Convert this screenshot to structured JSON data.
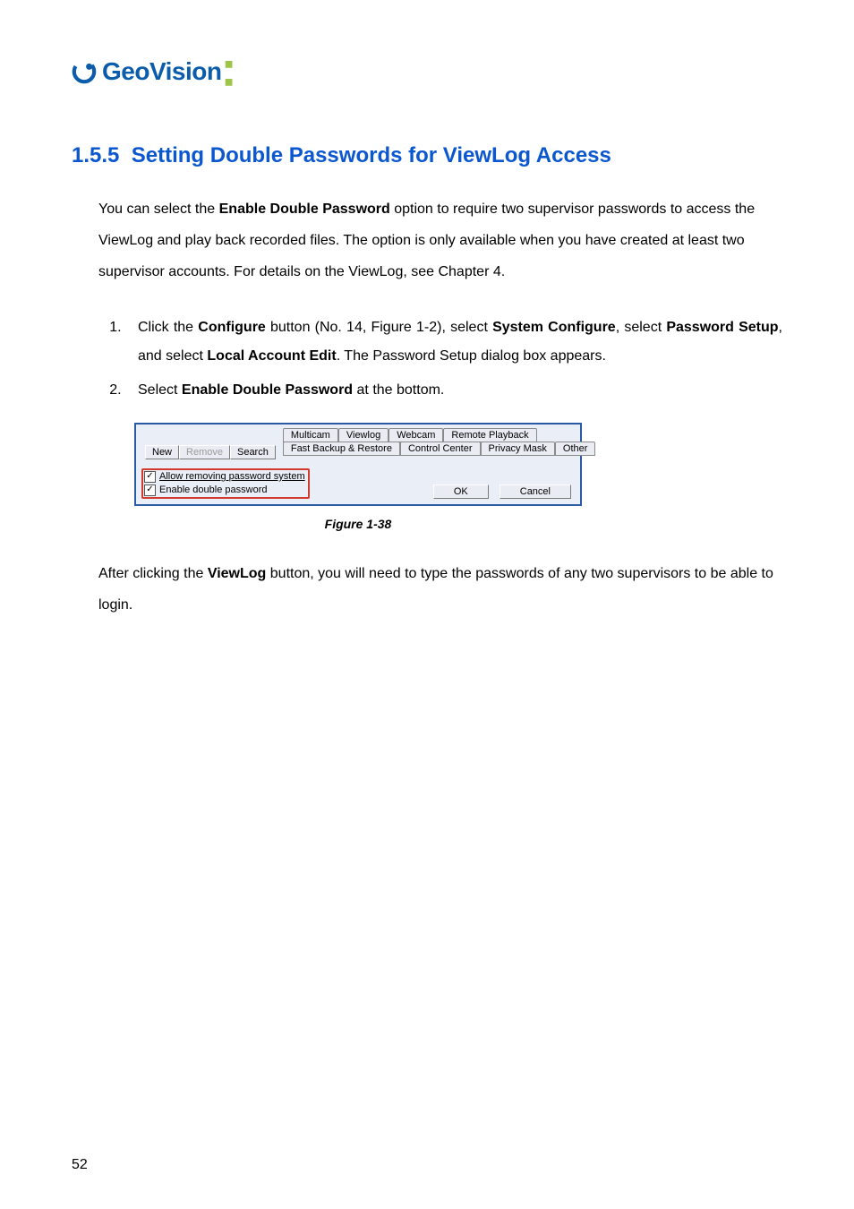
{
  "logo": {
    "brand": "GeoVision"
  },
  "heading": {
    "num": "1.5.5",
    "title": "Setting Double Passwords for ViewLog Access"
  },
  "para1": {
    "pre": "You can select the ",
    "bold1": "Enable Double Password",
    "post": " option to require two supervisor passwords to access the ViewLog and play back recorded files. The option is only available when you have created at least two supervisor accounts. For details on the ViewLog, see Chapter 4."
  },
  "steps": {
    "s1": {
      "a": "Click the ",
      "b": "Configure",
      "c": " button (No. 14, Figure 1-2), select ",
      "d": "System Configure",
      "e": ", select ",
      "f": "Password Setup",
      "g": ", and select ",
      "h": "Local Account Edit",
      "i": ". The Password Setup dialog box appears."
    },
    "s2": {
      "a": "Select ",
      "b": "Enable Double Password",
      "c": " at the bottom."
    }
  },
  "dialog": {
    "buttons": {
      "new": "New",
      "remove": "Remove",
      "search": "Search"
    },
    "tabs_row1": {
      "multicam": "Multicam",
      "viewlog": "Viewlog",
      "webcam": "Webcam",
      "remote": "Remote Playback"
    },
    "tabs_row2": {
      "fastbackup": "Fast Backup & Restore",
      "control": "Control Center",
      "privacy": "Privacy Mask",
      "other": "Other"
    },
    "check1": "Allow removing password system",
    "check2": "Enable double password",
    "ok": "OK",
    "cancel": "Cancel",
    "checkmark": "✓"
  },
  "figure_caption": "Figure 1-38",
  "para2": {
    "pre": "After clicking the ",
    "bold": "ViewLog",
    "post": " button, you will need to type the passwords of any two supervisors to be able to login."
  },
  "page_number": "52"
}
